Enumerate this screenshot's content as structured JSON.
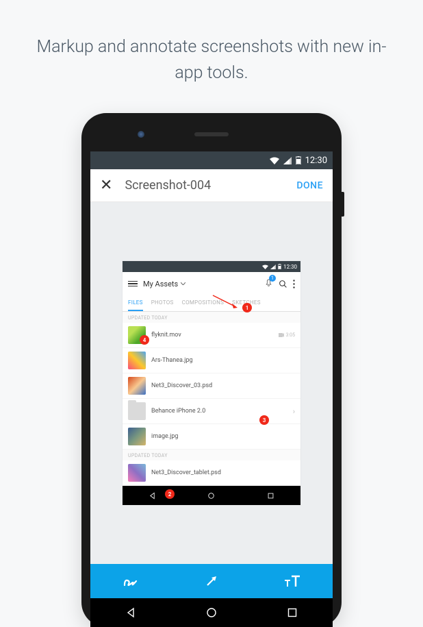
{
  "headline": "Markup and annotate screenshots with new in-app tools.",
  "statusbar": {
    "time": "12:30"
  },
  "appbar": {
    "title": "Screenshot-004",
    "done": "DONE"
  },
  "inner": {
    "status_time": "12:30",
    "title": "My Assets",
    "bell_badge": "1",
    "tabs": {
      "files": "FILES",
      "photos": "PHOTOS",
      "compositions": "COMPOSITIONS",
      "sketches": "SKETCHES"
    },
    "section1": "UPDATED TODAY",
    "section2": "UPDATED TODAY",
    "files": [
      {
        "name": "flyknit.mov",
        "meta": "3:05"
      },
      {
        "name": "Ars-Thanea.jpg"
      },
      {
        "name": "Net3_Discover_03.psd"
      },
      {
        "name": "Behance iPhone 2.0"
      },
      {
        "name": "image.jpg"
      },
      {
        "name": "Net3_Discover_tablet.psd"
      }
    ]
  },
  "annotations": {
    "a1": "1",
    "a2": "2",
    "a3": "3",
    "a4": "4"
  }
}
